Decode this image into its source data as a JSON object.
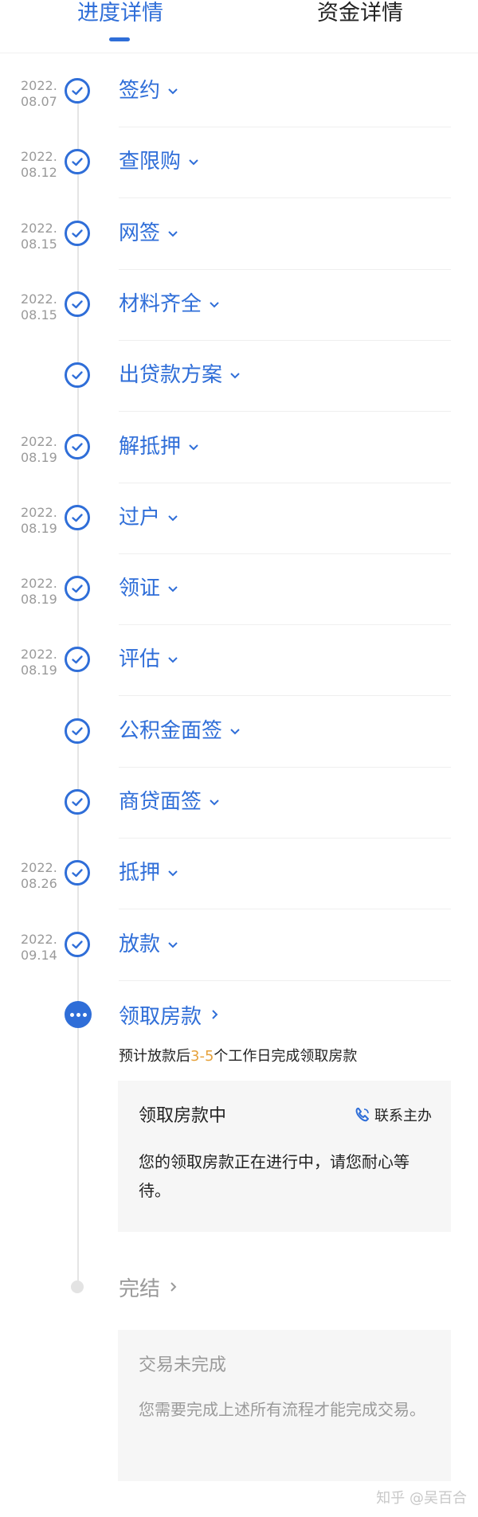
{
  "tabs": [
    {
      "label": "进度详情",
      "active": true
    },
    {
      "label": "资金详情",
      "active": false
    }
  ],
  "steps": [
    {
      "label": "签约",
      "date_year": "2022.",
      "date_md": "08.07",
      "icon": "check-circle-icon"
    },
    {
      "label": "查限购",
      "date_year": "2022.",
      "date_md": "08.12",
      "icon": "check-circle-icon"
    },
    {
      "label": "网签",
      "date_year": "2022.",
      "date_md": "08.15",
      "icon": "check-circle-icon"
    },
    {
      "label": "材料齐全",
      "date_year": "2022.",
      "date_md": "08.15",
      "icon": "check-circle-icon"
    },
    {
      "label": "出贷款方案",
      "date_year": "",
      "date_md": "",
      "icon": "check-circle-icon"
    },
    {
      "label": "解抵押",
      "date_year": "2022.",
      "date_md": "08.19",
      "icon": "check-circle-icon"
    },
    {
      "label": "过户",
      "date_year": "2022.",
      "date_md": "08.19",
      "icon": "check-circle-icon"
    },
    {
      "label": "领证",
      "date_year": "2022.",
      "date_md": "08.19",
      "icon": "check-circle-icon"
    },
    {
      "label": "评估",
      "date_year": "2022.",
      "date_md": "08.19",
      "icon": "check-circle-icon"
    },
    {
      "label": "公积金面签",
      "date_year": "",
      "date_md": "",
      "icon": "check-circle-icon"
    },
    {
      "label": "商贷面签",
      "date_year": "",
      "date_md": "",
      "icon": "check-circle-icon"
    },
    {
      "label": "抵押",
      "date_year": "2022.",
      "date_md": "08.26",
      "icon": "check-circle-icon"
    },
    {
      "label": "放款",
      "date_year": "2022.",
      "date_md": "09.14",
      "icon": "check-circle-icon"
    }
  ],
  "active_step": {
    "label": "领取房款",
    "estimate_prefix": "预计放款后",
    "estimate_highlight": "3-5",
    "estimate_suffix": "个工作日完成领取房款",
    "card_title": "领取房款中",
    "contact_label": "联系主办",
    "card_desc": "您的领取房款正在进行中，请您耐心等待。"
  },
  "final_step": {
    "label": "完结",
    "card_title": "交易未完成",
    "card_desc": "您需要完成上述所有流程才能完成交易。"
  },
  "watermark": "知乎 @吴百合",
  "colors": {
    "accent": "#2f6ed8",
    "highlight": "#e6a23c",
    "muted": "#9a9a9a",
    "card_bg": "#f6f6f6"
  }
}
